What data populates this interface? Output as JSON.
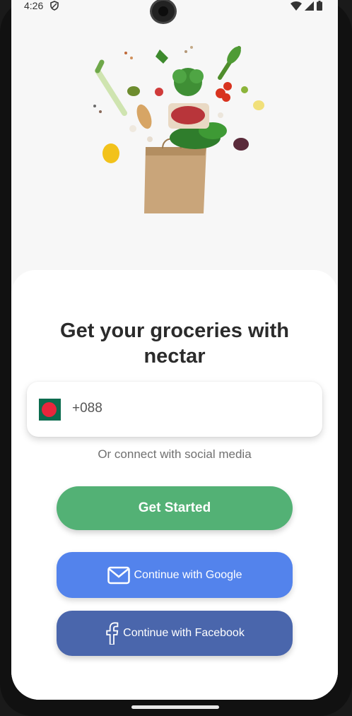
{
  "status_bar": {
    "time": "4:26"
  },
  "hero": {
    "image": "grocery-bag-with-vegetables"
  },
  "login": {
    "headline_line1": "Get your groceries with",
    "headline_line2": "nectar",
    "phone_code": "+088",
    "flag": "bangladesh-flag",
    "social_hint": "Or connect with social media",
    "get_started_label": "Get Started",
    "google_label": "Continue with Google",
    "facebook_label": "Continue with Facebook"
  },
  "colors": {
    "primary_green": "#53B175",
    "google_blue": "#5383EC",
    "facebook_blue": "#4A66AC"
  }
}
